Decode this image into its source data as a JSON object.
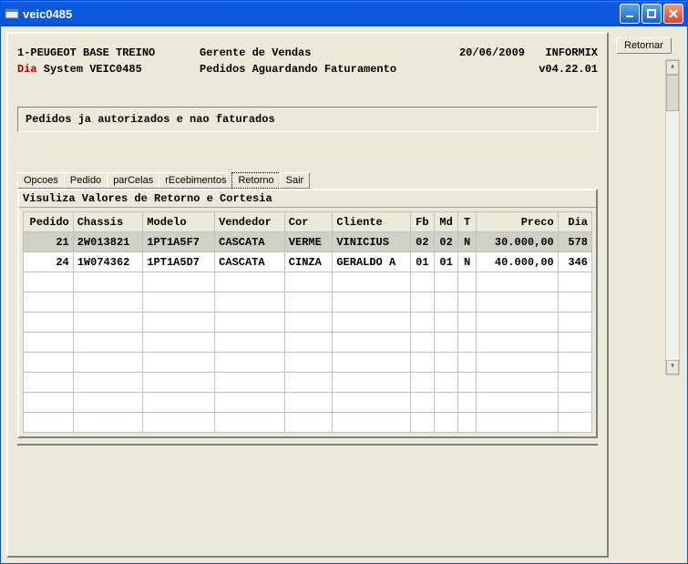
{
  "window": {
    "title": "veic0485"
  },
  "sidebar": {
    "retornar": "Retornar"
  },
  "header": {
    "company": "1-PEUGEOT BASE TREINO",
    "role": "Gerente de Vendas",
    "date": "20/06/2009",
    "db": "INFORMIX",
    "sys_prefix": "Dia",
    "sys_rest": " System  VEIC0485",
    "subtitle": "Pedidos Aguardando Faturamento",
    "version": "v04.22.01"
  },
  "message": "Pedidos ja autorizados e nao faturados",
  "menu": {
    "items": [
      "Opcoes",
      "Pedido",
      "parCelas",
      "rEcebimentos",
      "Retorno",
      "Sair"
    ],
    "active_index": 4
  },
  "grid": {
    "title": "Visuliza Valores de Retorno e Cortesia",
    "columns": [
      "Pedido",
      "Chassis",
      "Modelo",
      "Vendedor",
      "Cor",
      "Cliente",
      "Fb",
      "Md",
      "T",
      "Preco",
      "Dia"
    ],
    "rows": [
      {
        "pedido": "21",
        "chassis": "2W013821",
        "modelo": "1PT1A5F7",
        "vendedor": "CASCATA",
        "cor": "VERME",
        "cliente": "VINICIUS",
        "fb": "02",
        "md": "02",
        "t": "N",
        "preco": "30.000,00",
        "dia": "578",
        "selected": true
      },
      {
        "pedido": "24",
        "chassis": "1W074362",
        "modelo": "1PT1A5D7",
        "vendedor": "CASCATA",
        "cor": "CINZA",
        "cliente": "GERALDO A",
        "fb": "01",
        "md": "01",
        "t": "N",
        "preco": "40.000,00",
        "dia": "346",
        "selected": false
      }
    ],
    "empty_rows": 8
  }
}
